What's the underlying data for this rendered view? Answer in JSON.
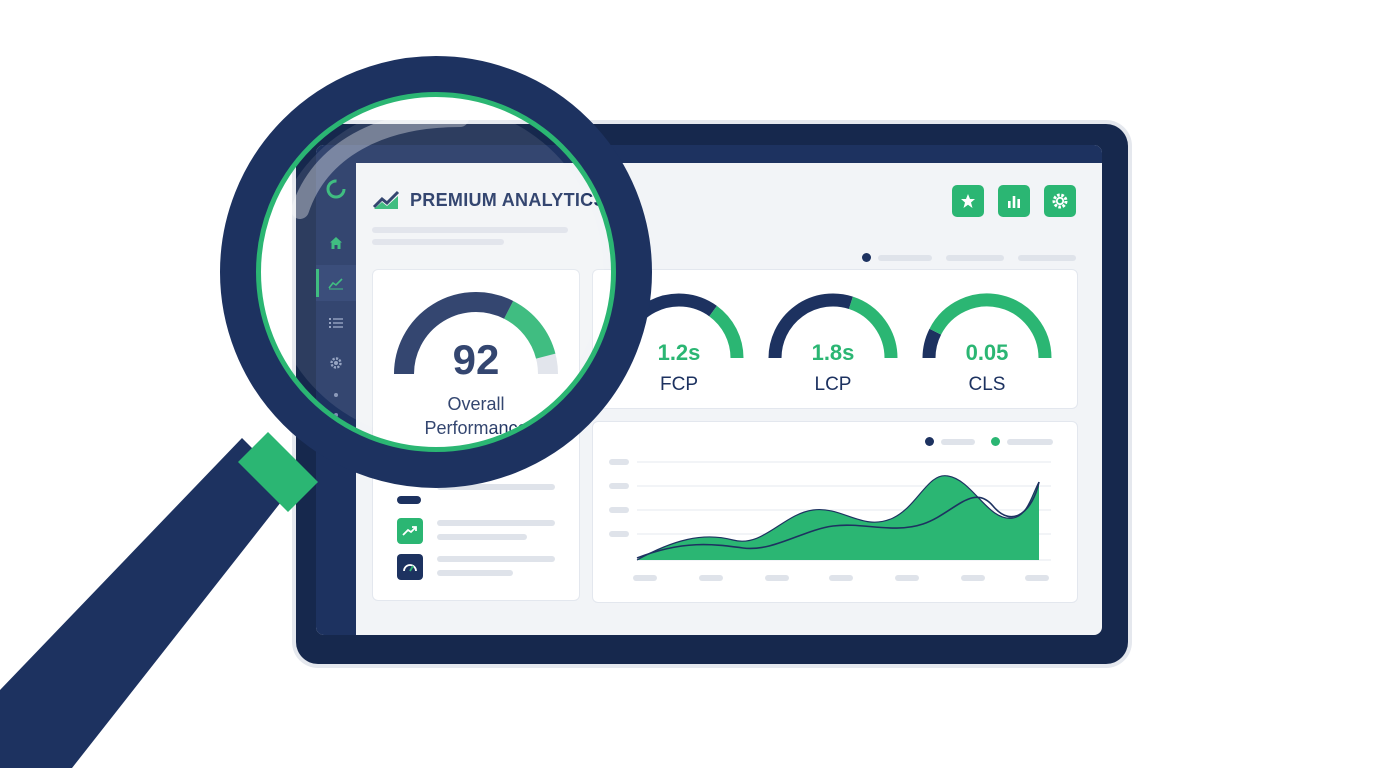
{
  "app": {
    "title": "PREMIUM ANALYTICS"
  },
  "header_buttons": [
    {
      "icon": "star-icon"
    },
    {
      "icon": "bar-chart-icon"
    },
    {
      "icon": "gear-icon"
    }
  ],
  "sidebar": {
    "items": [
      {
        "icon": "home-icon",
        "active": false
      },
      {
        "icon": "trend-chart-icon",
        "active": true
      },
      {
        "icon": "list-icon",
        "active": false
      },
      {
        "icon": "gear-icon",
        "active": false
      }
    ]
  },
  "overall": {
    "score": "92",
    "score_fraction": 0.92,
    "label_line1": "Overall",
    "label_line2": "Performance"
  },
  "metrics": [
    {
      "value": "1.2s",
      "label": "FCP",
      "fill_fraction": 0.3
    },
    {
      "value": "1.8s",
      "label": "LCP",
      "fill_fraction": 0.4
    },
    {
      "value": "0.05",
      "label": "CLS",
      "fill_fraction": 0.85
    }
  ],
  "list_icons": [
    {
      "icon": "trend-up-icon",
      "color": "#2bb673"
    },
    {
      "icon": "speedometer-icon",
      "color": "#1d3260"
    }
  ],
  "colors": {
    "navy": "#1d3260",
    "green": "#2bb673",
    "light_gray": "#dfe3ea"
  }
}
